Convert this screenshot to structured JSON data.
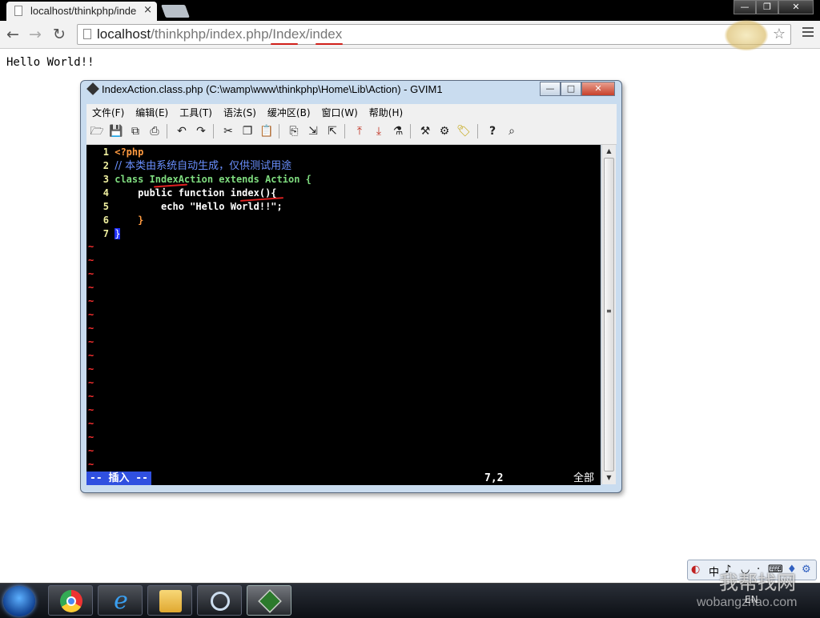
{
  "browser": {
    "tab_title": "localhost/thinkphp/inde",
    "tab_close": "×",
    "url_host": "localhost",
    "url_path": "/thinkphp/index.php/Index/index",
    "window_buttons": [
      "—",
      "❐",
      "✕"
    ]
  },
  "page": {
    "content_text": "Hello World!!"
  },
  "gvim": {
    "title": "IndexAction.class.php (C:\\wamp\\www\\thinkphp\\Home\\Lib\\Action) - GVIM1",
    "window_buttons": [
      "—",
      "□",
      "✕"
    ],
    "menus": [
      "文件(F)",
      "编辑(E)",
      "工具(T)",
      "语法(S)",
      "缓冲区(B)",
      "窗口(W)",
      "帮助(H)"
    ],
    "toolbar_icons": [
      "open-icon",
      "save-icon",
      "save-all-icon",
      "print-icon",
      "undo-icon",
      "redo-icon",
      "cut-icon",
      "copy-icon",
      "paste-icon",
      "replace-icon",
      "find-next-icon",
      "find-prev-icon",
      "load-session-icon",
      "save-session-icon",
      "run-script-icon",
      "make-icon",
      "shell-icon",
      "tags-icon",
      "help-icon",
      "find-help-icon"
    ],
    "lines": [
      {
        "n": "1",
        "code": "<?php"
      },
      {
        "n": "2",
        "code": "// 本类由系统自动生成，仅供测试用途"
      },
      {
        "n": "3",
        "code": "class IndexAction extends Action {"
      },
      {
        "n": "4",
        "code": "    public function index(){"
      },
      {
        "n": "5",
        "code": "        echo \"Hello World!!\";"
      },
      {
        "n": "6",
        "code": "    }"
      },
      {
        "n": "7",
        "code": "}"
      }
    ],
    "tilde": "~",
    "status_mode": "-- 插入 --",
    "status_pos": "7,2",
    "status_range": "全部"
  },
  "taskbar": {
    "apps": [
      "chrome-icon",
      "internet-explorer-icon",
      "explorer-folder-icon",
      "search-magnifier-icon",
      "gvim-icon"
    ],
    "tray_lang": "EN"
  },
  "watermark": {
    "site": "wobangzhao.com",
    "cn": "我帮找网"
  },
  "colors": {
    "accent_underline": "#d0201a",
    "vim_bg": "#000000",
    "insert_mode_bg": "#3050e0"
  }
}
